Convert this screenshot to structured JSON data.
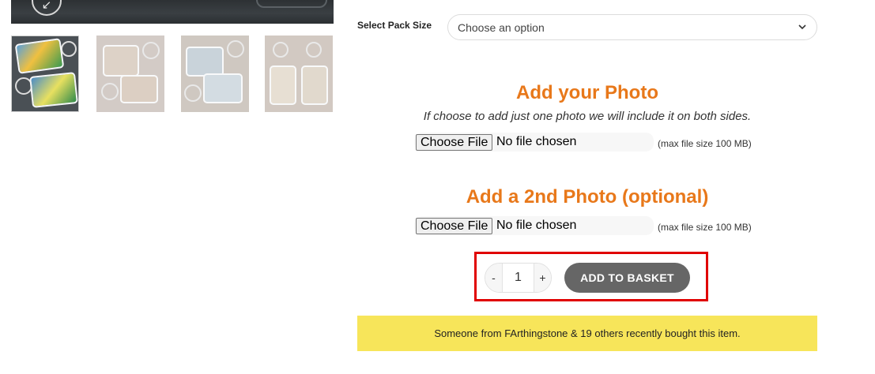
{
  "gallery": {
    "zoom_icon": "expand-arrow-icon",
    "thumbnails": [
      {
        "alt": "photo keyrings on dark wood",
        "active": true
      },
      {
        "alt": "photo keyrings",
        "active": false
      },
      {
        "alt": "photo keyrings",
        "active": false
      },
      {
        "alt": "rectangle photo keyrings",
        "active": false
      }
    ]
  },
  "pack_size": {
    "label": "Select Pack Size",
    "selected": "Choose an option"
  },
  "photo1": {
    "heading": "Add your Photo",
    "hint": "If choose to add just one photo we will include it on both sides.",
    "button": "Choose File",
    "status": "No file chosen",
    "max_size": "(max file size 100 MB)"
  },
  "photo2": {
    "heading": "Add a 2nd Photo (optional)",
    "button": "Choose File",
    "status": "No file chosen",
    "max_size": "(max file size 100 MB)"
  },
  "quantity": {
    "minus": "-",
    "value": "1",
    "plus": "+"
  },
  "add_to_basket": "ADD TO BASKET",
  "notice": "Someone from FArthingstone & 19 others recently bought this item.",
  "colors": {
    "accent_orange": "#e8781a",
    "button_grey": "#666666",
    "notice_yellow": "#f7e55a",
    "highlight_red": "#e00000"
  }
}
